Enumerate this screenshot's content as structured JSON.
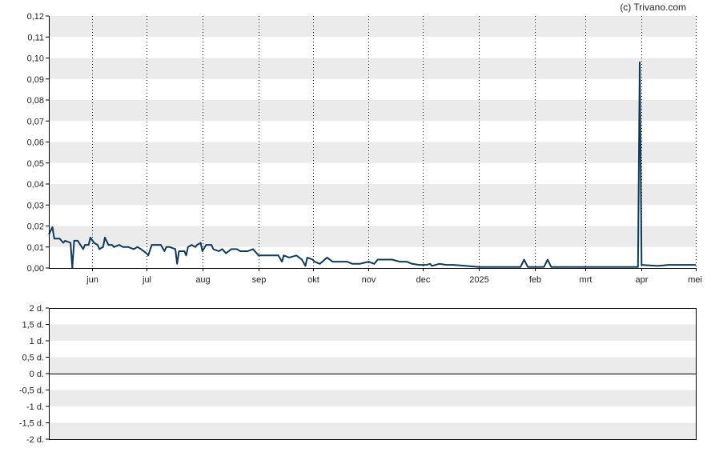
{
  "watermark": "(c) Trivano.com",
  "colors": {
    "line": "#0f3b5c",
    "band": "#ebebeb",
    "axis": "#000000",
    "vgrid": "#000000"
  },
  "chart_data": [
    {
      "type": "line",
      "title": "",
      "xlabel": "",
      "ylabel": "",
      "ylim": [
        0,
        0.12
      ],
      "grid": true,
      "yticks": [
        {
          "value": 0.0,
          "label": "0,00"
        },
        {
          "value": 0.01,
          "label": "0,01"
        },
        {
          "value": 0.02,
          "label": "0,02"
        },
        {
          "value": 0.03,
          "label": "0,03"
        },
        {
          "value": 0.04,
          "label": "0,04"
        },
        {
          "value": 0.05,
          "label": "0,05"
        },
        {
          "value": 0.06,
          "label": "0,06"
        },
        {
          "value": 0.07,
          "label": "0,07"
        },
        {
          "value": 0.08,
          "label": "0,08"
        },
        {
          "value": 0.09,
          "label": "0,09"
        },
        {
          "value": 0.1,
          "label": "0,10"
        },
        {
          "value": 0.11,
          "label": "0,11"
        },
        {
          "value": 0.12,
          "label": "0,12"
        }
      ],
      "xlim": [
        "2024-05-08",
        "2025-05-01"
      ],
      "xticks": [
        {
          "date": "2024-06-01",
          "label": "jun"
        },
        {
          "date": "2024-07-01",
          "label": "jul"
        },
        {
          "date": "2024-08-01",
          "label": "aug"
        },
        {
          "date": "2024-09-01",
          "label": "sep"
        },
        {
          "date": "2024-10-01",
          "label": "okt"
        },
        {
          "date": "2024-11-01",
          "label": "nov"
        },
        {
          "date": "2024-12-01",
          "label": "dec"
        },
        {
          "date": "2025-01-01",
          "label": "2025"
        },
        {
          "date": "2025-02-01",
          "label": "feb"
        },
        {
          "date": "2025-03-01",
          "label": "mrt"
        },
        {
          "date": "2025-04-01",
          "label": "apr"
        },
        {
          "date": "2025-05-01",
          "label": "mei"
        }
      ],
      "series": [
        {
          "points": [
            [
              "2024-05-08",
              0.016
            ],
            [
              "2024-05-10",
              0.0195
            ],
            [
              "2024-05-11",
              0.014
            ],
            [
              "2024-05-14",
              0.014
            ],
            [
              "2024-05-16",
              0.012
            ],
            [
              "2024-05-17",
              0.013
            ],
            [
              "2024-05-20",
              0.012
            ],
            [
              "2024-05-21",
              0.0
            ],
            [
              "2024-05-22",
              0.013
            ],
            [
              "2024-05-24",
              0.013
            ],
            [
              "2024-05-27",
              0.009
            ],
            [
              "2024-05-28",
              0.011
            ],
            [
              "2024-05-30",
              0.011
            ],
            [
              "2024-05-31",
              0.0145
            ],
            [
              "2024-06-02",
              0.012
            ],
            [
              "2024-06-04",
              0.011
            ],
            [
              "2024-06-05",
              0.009
            ],
            [
              "2024-06-07",
              0.01
            ],
            [
              "2024-06-08",
              0.0145
            ],
            [
              "2024-06-10",
              0.011
            ],
            [
              "2024-06-12",
              0.011
            ],
            [
              "2024-06-13",
              0.01
            ],
            [
              "2024-06-16",
              0.011
            ],
            [
              "2024-06-18",
              0.01
            ],
            [
              "2024-06-21",
              0.01
            ],
            [
              "2024-06-24",
              0.009
            ],
            [
              "2024-06-26",
              0.01
            ],
            [
              "2024-06-28",
              0.009
            ],
            [
              "2024-07-01",
              0.007
            ],
            [
              "2024-07-02",
              0.006
            ],
            [
              "2024-07-04",
              0.011
            ],
            [
              "2024-07-09",
              0.011
            ],
            [
              "2024-07-11",
              0.008
            ],
            [
              "2024-07-12",
              0.01
            ],
            [
              "2024-07-14",
              0.01
            ],
            [
              "2024-07-17",
              0.009
            ],
            [
              "2024-07-18",
              0.002
            ],
            [
              "2024-07-19",
              0.008
            ],
            [
              "2024-07-22",
              0.008
            ],
            [
              "2024-07-23",
              0.006
            ],
            [
              "2024-07-24",
              0.01
            ],
            [
              "2024-07-26",
              0.011
            ],
            [
              "2024-07-28",
              0.01
            ],
            [
              "2024-07-29",
              0.011
            ],
            [
              "2024-07-31",
              0.012
            ],
            [
              "2024-08-01",
              0.008
            ],
            [
              "2024-08-03",
              0.011
            ],
            [
              "2024-08-06",
              0.011
            ],
            [
              "2024-08-07",
              0.009
            ],
            [
              "2024-08-10",
              0.008
            ],
            [
              "2024-08-12",
              0.009
            ],
            [
              "2024-08-14",
              0.007
            ],
            [
              "2024-08-17",
              0.009
            ],
            [
              "2024-08-20",
              0.009
            ],
            [
              "2024-08-22",
              0.008
            ],
            [
              "2024-08-26",
              0.008
            ],
            [
              "2024-08-29",
              0.009
            ],
            [
              "2024-08-31",
              0.007
            ],
            [
              "2024-09-01",
              0.006
            ],
            [
              "2024-09-12",
              0.006
            ],
            [
              "2024-09-14",
              0.003
            ],
            [
              "2024-09-15",
              0.006
            ],
            [
              "2024-09-18",
              0.005
            ],
            [
              "2024-09-22",
              0.006
            ],
            [
              "2024-09-25",
              0.004
            ],
            [
              "2024-09-27",
              0.001
            ],
            [
              "2024-09-28",
              0.005
            ],
            [
              "2024-10-01",
              0.004
            ],
            [
              "2024-10-02",
              0.003
            ],
            [
              "2024-10-05",
              0.002
            ],
            [
              "2024-10-09",
              0.005
            ],
            [
              "2024-10-12",
              0.003
            ],
            [
              "2024-10-16",
              0.003
            ],
            [
              "2024-10-20",
              0.003
            ],
            [
              "2024-10-23",
              0.002
            ],
            [
              "2024-10-27",
              0.002
            ],
            [
              "2024-11-01",
              0.003
            ],
            [
              "2024-11-04",
              0.002
            ],
            [
              "2024-11-06",
              0.004
            ],
            [
              "2024-11-10",
              0.004
            ],
            [
              "2024-11-14",
              0.004
            ],
            [
              "2024-11-18",
              0.003
            ],
            [
              "2024-11-22",
              0.003
            ],
            [
              "2024-11-25",
              0.002
            ],
            [
              "2024-11-29",
              0.0015
            ],
            [
              "2024-12-03",
              0.0015
            ],
            [
              "2024-12-05",
              0.002
            ],
            [
              "2024-12-06",
              0.001
            ],
            [
              "2024-12-10",
              0.002
            ],
            [
              "2024-12-14",
              0.0015
            ],
            [
              "2024-12-18",
              0.0015
            ],
            [
              "2024-12-25",
              0.001
            ],
            [
              "2025-01-01",
              0.0005
            ],
            [
              "2025-01-12",
              0.0005
            ],
            [
              "2025-01-24",
              0.0005
            ],
            [
              "2025-01-26",
              0.004
            ],
            [
              "2025-01-28",
              0.0005
            ],
            [
              "2025-02-06",
              0.0005
            ],
            [
              "2025-02-08",
              0.004
            ],
            [
              "2025-02-10",
              0.0005
            ],
            [
              "2025-02-16",
              0.0005
            ],
            [
              "2025-02-22",
              0.0005
            ],
            [
              "2025-03-05",
              0.0005
            ],
            [
              "2025-03-15",
              0.0005
            ],
            [
              "2025-03-25",
              0.0005
            ],
            [
              "2025-03-30",
              0.0005
            ],
            [
              "2025-03-31",
              0.098
            ],
            [
              "2025-04-01",
              0.0015
            ],
            [
              "2025-04-10",
              0.001
            ],
            [
              "2025-04-16",
              0.0015
            ],
            [
              "2025-05-01",
              0.0015
            ]
          ]
        }
      ]
    },
    {
      "type": "line",
      "title": "",
      "xlabel": "",
      "ylabel": "",
      "ylim": [
        -2,
        2
      ],
      "grid": true,
      "yticks": [
        {
          "value": 2,
          "label": "2 d."
        },
        {
          "value": 1.5,
          "label": "1,5 d."
        },
        {
          "value": 1,
          "label": "1 d."
        },
        {
          "value": 0.5,
          "label": "0,5 d."
        },
        {
          "value": 0,
          "label": "0 d."
        },
        {
          "value": -0.5,
          "label": "-0,5 d."
        },
        {
          "value": -1,
          "label": "-1 d."
        },
        {
          "value": -1.5,
          "label": "-1,5 d."
        },
        {
          "value": -2,
          "label": "-2 d."
        }
      ],
      "series": []
    }
  ]
}
